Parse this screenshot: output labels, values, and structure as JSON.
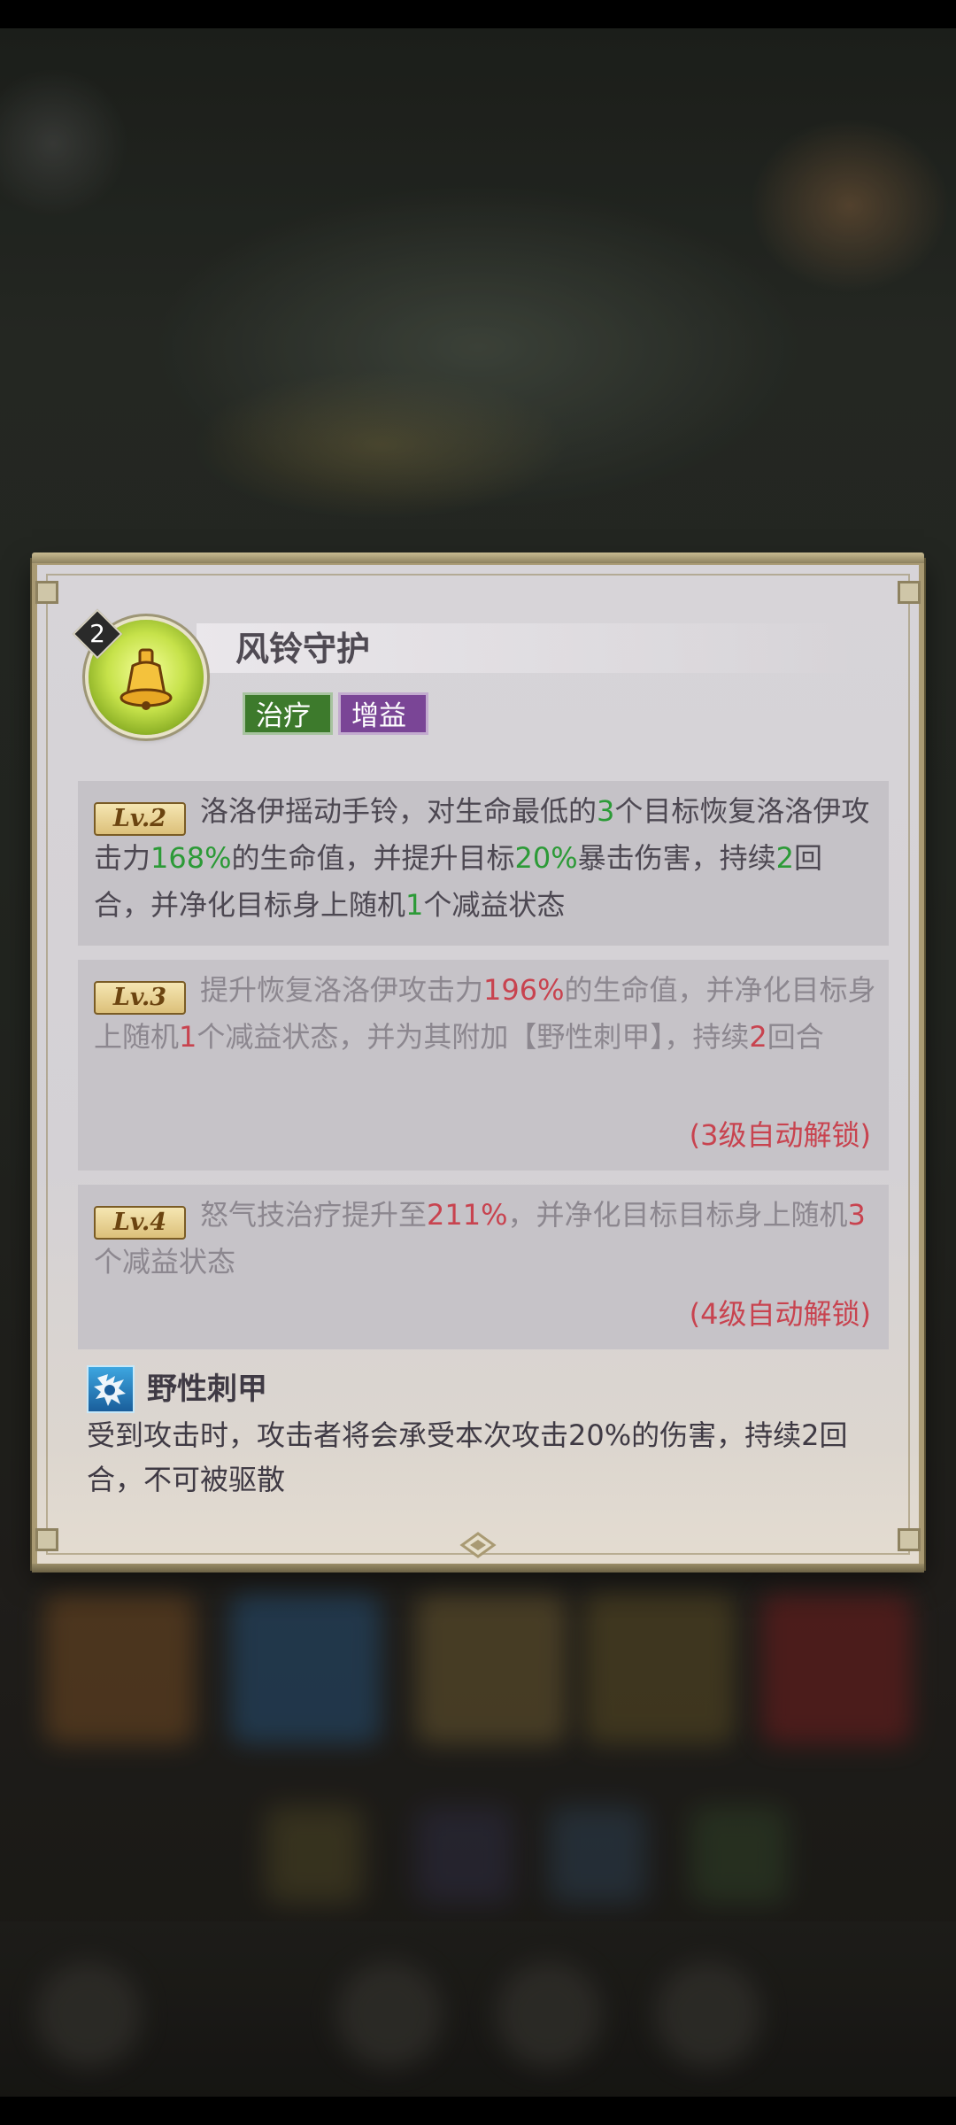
{
  "skill": {
    "level": "2",
    "name": "风铃守护",
    "icon": "golden-bell-icon",
    "tags": [
      {
        "label": "治疗",
        "color": "#3d7a2c"
      },
      {
        "label": "增益",
        "color": "#7a4596"
      }
    ]
  },
  "levels": [
    {
      "badge": "Lv.2",
      "unlocked": true,
      "segments": [
        {
          "t": "洛洛伊摇动手铃，对生命最低的"
        },
        {
          "t": "3",
          "c": "g"
        },
        {
          "t": "个目标恢复洛洛伊攻击力"
        },
        {
          "t": "168%",
          "c": "g"
        },
        {
          "t": "的生命值，并提升目标"
        },
        {
          "t": "20%",
          "c": "g"
        },
        {
          "t": "暴击伤害，持续"
        },
        {
          "t": "2",
          "c": "g"
        },
        {
          "t": "回合，并净化目标身上随机"
        },
        {
          "t": "1",
          "c": "g"
        },
        {
          "t": "个减益状态"
        }
      ],
      "unlock_note": ""
    },
    {
      "badge": "Lv.3",
      "unlocked": false,
      "segments": [
        {
          "t": "提升恢复洛洛伊攻击力"
        },
        {
          "t": "196%",
          "c": "r"
        },
        {
          "t": "的生命值，并净化目标身上随机"
        },
        {
          "t": "1",
          "c": "r"
        },
        {
          "t": "个减益状态，并为其附加【野性刺甲】，持续"
        },
        {
          "t": "2",
          "c": "r"
        },
        {
          "t": "回合"
        }
      ],
      "unlock_note": "(3级自动解锁)"
    },
    {
      "badge": "Lv.4",
      "unlocked": false,
      "segments": [
        {
          "t": "怒气技治疗提升至"
        },
        {
          "t": "211%",
          "c": "r"
        },
        {
          "t": "，并净化目标目标身上随机"
        },
        {
          "t": "3",
          "c": "r"
        },
        {
          "t": "个减益状态"
        }
      ],
      "unlock_note": "(4级自动解锁)"
    }
  ],
  "status_effect": {
    "icon": "spiked-armor-icon",
    "name": "野性刺甲",
    "description": "受到攻击时，攻击者将会承受本次攻击20%的伤害，持续2回合，不可被驱散"
  },
  "colors": {
    "highlight_unlocked": "#2c9a37",
    "highlight_locked": "#c8434f",
    "panel_border": "#a99a73"
  }
}
